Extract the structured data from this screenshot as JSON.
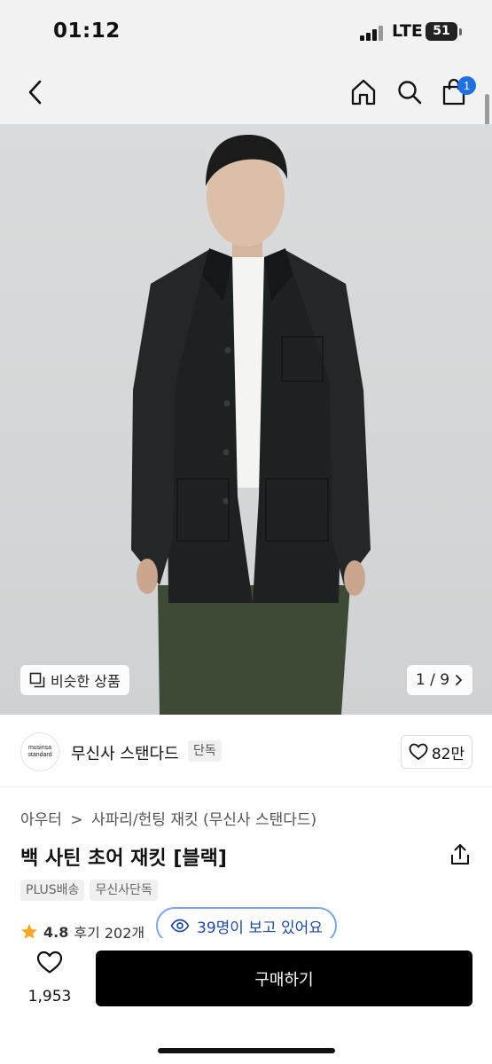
{
  "status_bar": {
    "time": "01:12",
    "network": "LTE",
    "battery": "51"
  },
  "nav": {
    "back_icon": "chevron-left-icon",
    "home_icon": "home-icon",
    "search_icon": "search-icon",
    "cart_icon": "cart-icon",
    "cart_badge": "1"
  },
  "image": {
    "similar_button": "비슷한 상품",
    "counter": "1 / 9"
  },
  "brand": {
    "logo_line1": "musinsa",
    "logo_line2": "standard",
    "name": "무신사 스탠다드",
    "tag": "단독",
    "likes": "82만"
  },
  "product": {
    "category": [
      "아우터",
      "사파리/헌팅 재킷 (무신사 스탠다드)"
    ],
    "category_separator": ">",
    "title": "백 사틴 초어 재킷 [블랙]",
    "tags": [
      "PLUS배송",
      "무신사단독"
    ],
    "rating": "4.8",
    "reviews": "후기 202개",
    "viewers": "39명이 보고 있어요"
  },
  "bottom_bar": {
    "wish_count": "1,953",
    "buy_label": "구매하기"
  },
  "colors": {
    "accent_blue": "#1f6fe5",
    "star": "#f5a623",
    "buy_button": "#000000"
  }
}
